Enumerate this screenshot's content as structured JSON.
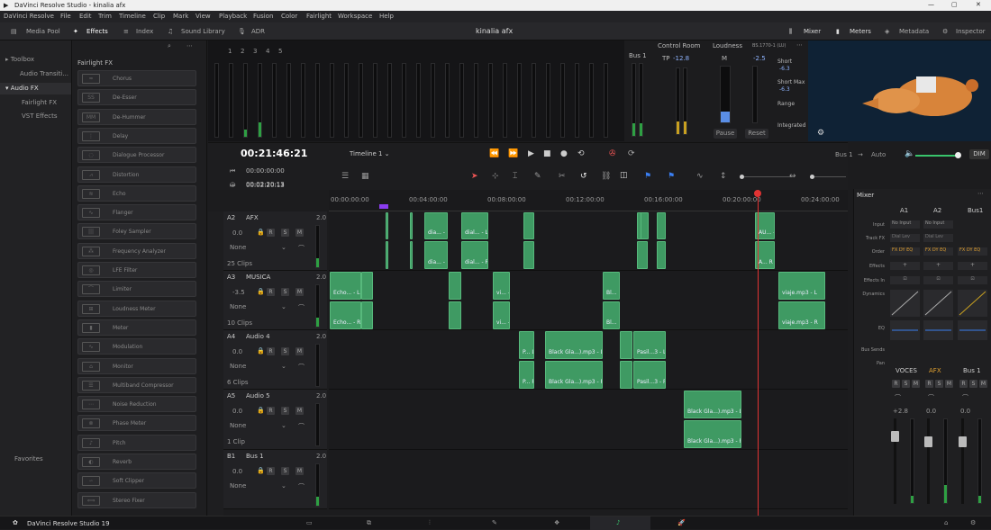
{
  "window": {
    "title": "DaVinci Resolve Studio - kinalia afx"
  },
  "menu": [
    "DaVinci Resolve",
    "File",
    "Edit",
    "Trim",
    "Timeline",
    "Clip",
    "Mark",
    "View",
    "Playback",
    "Fusion",
    "Color",
    "Fairlight",
    "Workspace",
    "Help"
  ],
  "toolbar": {
    "media_pool": "Media Pool",
    "effects": "Effects",
    "index": "Index",
    "sound_library": "Sound Library",
    "adr": "ADR",
    "project": "kinalia afx",
    "mixer": "Mixer",
    "meters": "Meters",
    "metadata": "Metadata",
    "inspector": "Inspector"
  },
  "sidebar": {
    "toolbox": "Toolbox",
    "audio_transitions": "Audio Transiti...",
    "audio_fx": "Audio FX",
    "fairlight_fx": "Fairlight FX",
    "vst_effects": "VST Effects",
    "favorites": "Favorites"
  },
  "fx": {
    "header": "Fairlight FX",
    "items": [
      "Chorus",
      "De-Esser",
      "De-Hummer",
      "Delay",
      "Dialogue Processor",
      "Distortion",
      "Echo",
      "Flanger",
      "Foley Sampler",
      "Frequency Analyzer",
      "LFE Filter",
      "Limiter",
      "Loudness Meter",
      "Meter",
      "Modulation",
      "Monitor",
      "Multiband Compressor",
      "Noise Reduction",
      "Phase Meter",
      "Pitch",
      "Reverb",
      "Soft Clipper",
      "Stereo Fixer"
    ],
    "icons": [
      "SS",
      "MM"
    ]
  },
  "meters": {
    "bus": "Bus 1",
    "control_room": "Control Room",
    "tp": "TP",
    "tp_val": "-12.8",
    "loudness": "Loudness",
    "loud_std": "BS.1770-1 (LU)",
    "m": "M",
    "m_val": "-2.5",
    "short": "Short",
    "short_val": "-6.3",
    "short_max": "Short Max",
    "short_max_val": "-6.3",
    "range": "Range",
    "integrated": "Integrated",
    "pause": "Pause",
    "reset": "Reset",
    "ch": [
      "1",
      "2",
      "3",
      "4",
      "5"
    ]
  },
  "transport": {
    "timecode": "00:21:46:21",
    "timeline": "Timeline 1",
    "bus": "Bus 1",
    "auto": "Auto",
    "dim": "DIM"
  },
  "tc": {
    "a": "00:00:00:00",
    "b": "00:02:20:13",
    "c": "00:02:20:13"
  },
  "ruler": [
    "00:00:00:00",
    "00:04:00:00",
    "00:08:00:00",
    "00:12:00:00",
    "00:16:00:00",
    "00:20:00:00",
    "00:24:00:00"
  ],
  "tracks": [
    {
      "id": "A2",
      "name": "AFX",
      "ch": "2.0",
      "vol": "0.0",
      "mode": "None",
      "clips": "25 Clips"
    },
    {
      "id": "A3",
      "name": "MUSICA",
      "ch": "2.0",
      "vol": "-3.5",
      "mode": "None",
      "clips": "10 Clips"
    },
    {
      "id": "A4",
      "name": "Audio 4",
      "ch": "2.0",
      "vol": "0.0",
      "mode": "None",
      "clips": "6 Clips"
    },
    {
      "id": "A5",
      "name": "Audio 5",
      "ch": "2.0",
      "vol": "0.0",
      "mode": "None",
      "clips": "1 Clip"
    },
    {
      "id": "B1",
      "name": "Bus 1",
      "ch": "2.0",
      "vol": "0.0",
      "mode": "None",
      "clips": ""
    }
  ],
  "btns": {
    "r": "R",
    "s": "S",
    "m": "M"
  },
  "cliplabels": {
    "dia_l": "dia... - L",
    "dia_r": "dia... - R",
    "dial_l": "dial... - L",
    "dial_r": "dial... - R",
    "au_l": "AU... - L",
    "a_r": "A... R",
    "echo_l": "Echo... - L",
    "echo_r": "Echo... - R",
    "vi_l": "vi... - L",
    "vi_r": "vi... - R",
    "bl_l": "Bl...",
    "bl_r": "Bl...",
    "viaje_l": "viaje.mp3 - L",
    "viaje_r": "viaje.mp3 - R",
    "p_l": "P... L",
    "p_r": "P... R",
    "bg_l": "Black Gla...).mp3 - L",
    "bg_r": "Black Gla...).mp3 - R",
    "pasil_l": "Pasil...3 - L",
    "pasil_r": "Pasil...3 - R"
  },
  "mixer": {
    "title": "Mixer",
    "cols": [
      "A1",
      "A2",
      "Bus1"
    ],
    "rows": [
      "Input",
      "Track FX",
      "Order",
      "Effects",
      "Effects In",
      "Dynamics",
      "EQ",
      "Bus Sends",
      "Pan"
    ],
    "input": "No Input",
    "trackfx": "Dial Lev",
    "order": "FX DY EQ",
    "names": [
      "VOCES",
      "AFX",
      "Bus 1"
    ],
    "vals": [
      "+2.8",
      "0.0",
      "0.0"
    ]
  },
  "status": {
    "app": "DaVinci Resolve Studio 19"
  },
  "colors": {
    "clip": "#3f9a63",
    "playhead": "#e03333",
    "accent": "#e0a030"
  }
}
